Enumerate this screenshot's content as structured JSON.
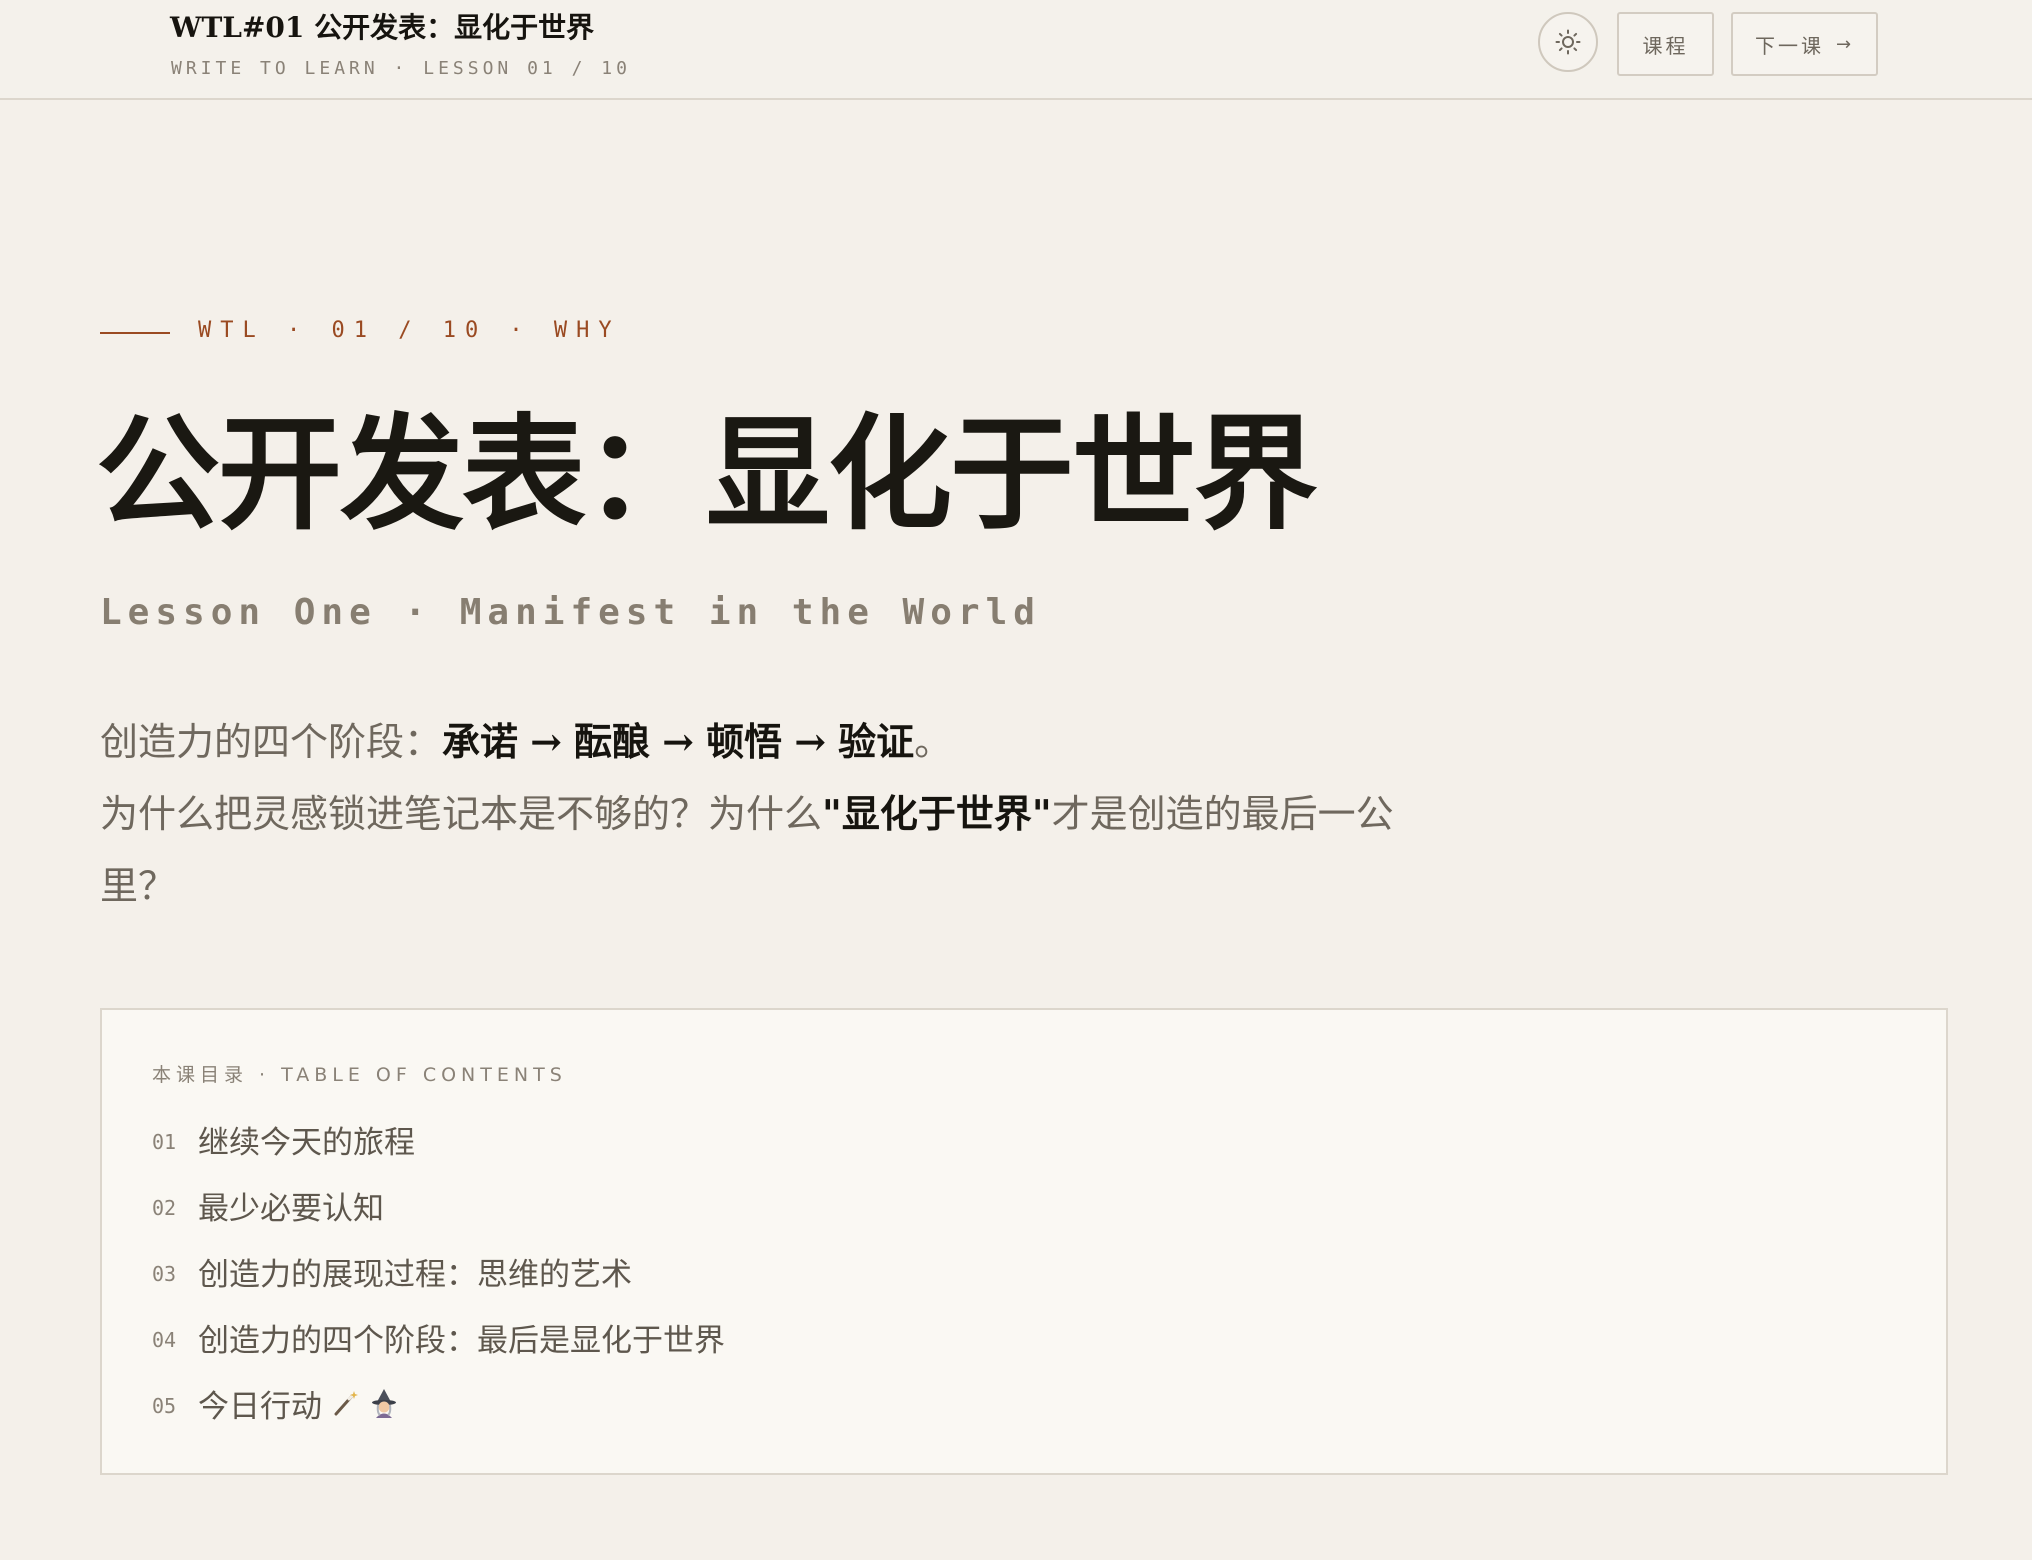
{
  "header": {
    "title": "WTL#01 公开发表：显化于世界",
    "subtitle": "WRITE TO LEARN · LESSON 01 / 10",
    "theme_toggle_icon": "sun-icon",
    "course_button": "课程",
    "next_button": "下一课",
    "next_arrow": "→"
  },
  "hero": {
    "eyebrow": "WTL · 01 / 10 · WHY",
    "title": "公开发表：显化于世界",
    "subtitle": "Lesson One · Manifest in the World"
  },
  "intro": {
    "line1_prefix": "创造力的四个阶段：",
    "line1_stage1": "承诺",
    "arrow": "→",
    "line1_stage2": "酝酿",
    "line1_stage3": "顿悟",
    "line1_stage4": "验证",
    "line1_suffix": "。",
    "line2_prefix": "为什么把灵感锁进笔记本是不够的？为什么",
    "line2_bold": "\"显化于世界\"",
    "line2_suffix": "才是创造的最后一公",
    "line3": "里？"
  },
  "toc": {
    "heading": "本课目录 · TABLE OF CONTENTS",
    "items": [
      {
        "num": "01",
        "label": "继续今天的旅程"
      },
      {
        "num": "02",
        "label": "最少必要认知"
      },
      {
        "num": "03",
        "label": "创造力的展现过程：思维的艺术"
      },
      {
        "num": "04",
        "label": "创造力的四个阶段：最后是显化于世界"
      },
      {
        "num": "05",
        "label": "今日行动",
        "icons": [
          "magic-wand-icon",
          "witch-icon"
        ]
      }
    ]
  },
  "colors": {
    "background": "#f4f0ea",
    "accent": "#9a4a22",
    "ink": "#1a1812",
    "muted": "#877e71"
  }
}
